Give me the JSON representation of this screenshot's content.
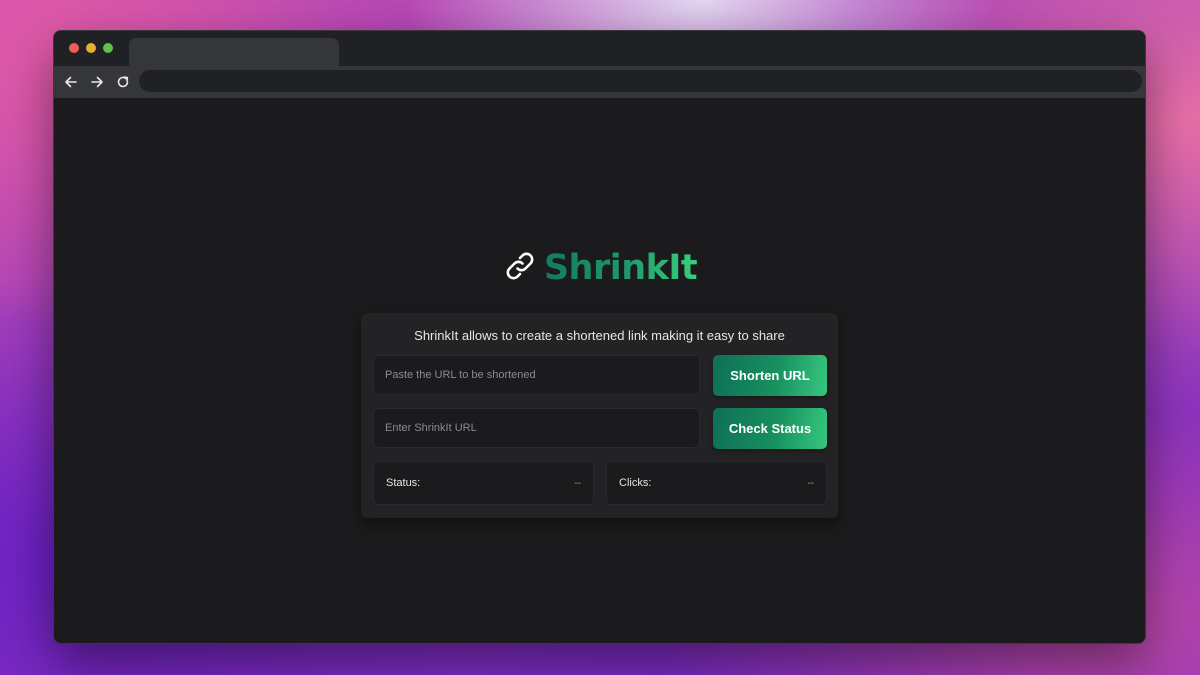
{
  "browser": {
    "tab_title": "",
    "address": "",
    "icons": {
      "back": "arrow-left-icon",
      "forward": "arrow-right-icon",
      "reload": "reload-icon"
    }
  },
  "app": {
    "logo_icon": "link-icon",
    "name": "ShrinkIt",
    "description": "ShrinkIt allows to create a shortened link making it easy to share",
    "url_input": {
      "placeholder": "Paste the URL to be shortened",
      "value": ""
    },
    "shorten_button": "Shorten URL",
    "shrinkit_input": {
      "placeholder": "Enter ShrinkIt URL",
      "value": ""
    },
    "check_button": "Check Status",
    "status": {
      "label": "Status:",
      "value": "--"
    },
    "clicks": {
      "label": "Clicks:",
      "value": "--"
    }
  },
  "colors": {
    "page_background": "#1b1b1d",
    "card_background": "#232325",
    "accent_start": "#0e6f57",
    "accent_end": "#37c77e",
    "value_text": "#3fd08a"
  }
}
